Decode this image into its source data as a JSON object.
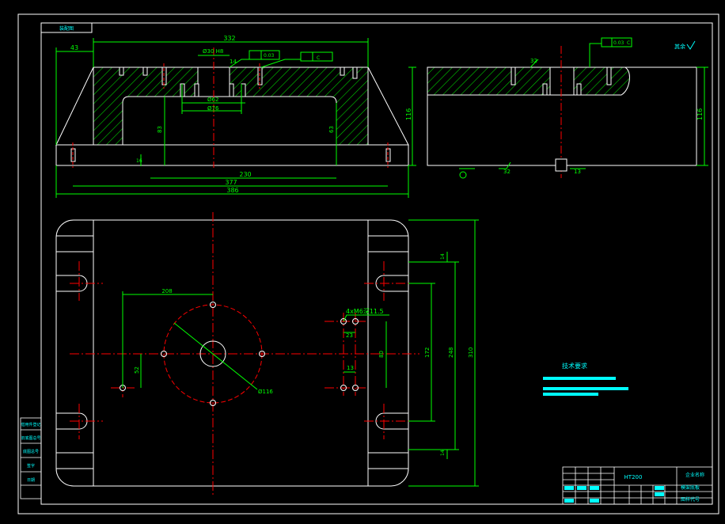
{
  "colors": {
    "background": "#000000",
    "outline": "#ffffff",
    "dimension": "#00ff00",
    "centerline": "#ff0000",
    "notes": "#00ffff",
    "hatch": "#00cc00"
  },
  "title_tab": "装配图",
  "surface_note": "其余",
  "front_view": {
    "dims": {
      "overall_width": "332",
      "left_offset": "43",
      "bore_dia": "Ø30 H8",
      "small_dia": "Ø62",
      "large_dia": "Ø76",
      "height_left": "83",
      "height_right": "63",
      "height_total": "116",
      "span_inner": "230",
      "span_mid": "377",
      "span_outer": "386",
      "base_height": "16",
      "flatness": "0.03",
      "datum": "C",
      "small_angle": "32",
      "depth": "14"
    }
  },
  "side_view": {
    "dims": {
      "height": "116",
      "parallelism": "0.03",
      "datum": "C",
      "angle": "32",
      "offset": "13"
    }
  },
  "plan_view": {
    "dims": {
      "hole_spacing": "208",
      "hole_note": "4xM6深11.5",
      "small_dim": "23",
      "v_52": "52",
      "v_80": "80",
      "v_172": "172",
      "v_248": "248",
      "v_310": "310",
      "v_14_top": "14",
      "v_14_bottom": "14",
      "hole_gap": "13",
      "pcd": "Ø116"
    }
  },
  "tech_req": {
    "title": "技术要求"
  },
  "title_block": {
    "material": "HT200",
    "company": "企业名称",
    "part_name": "模架底板",
    "drawing_no": "图样代号"
  },
  "left_tabs": [
    "借用件登记",
    "旧底图总号",
    "底图总号",
    "签字",
    "日期"
  ]
}
